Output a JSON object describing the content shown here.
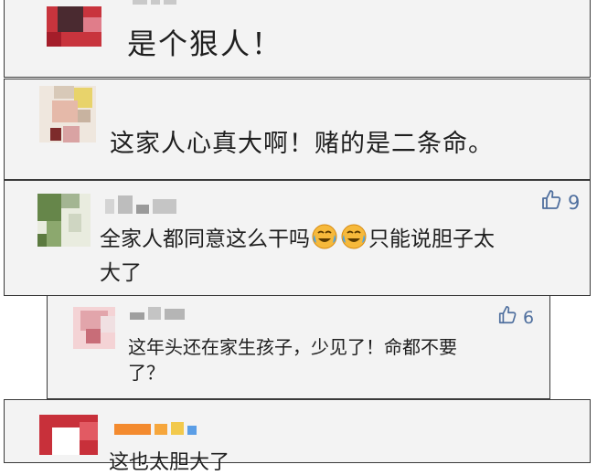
{
  "comments": [
    {
      "text": "是个狠人！"
    },
    {
      "text": "这家人心真大啊！赌的是二条命。"
    },
    {
      "text_part1": "全家人都同意这么干吗",
      "emoji": [
        "laugh-cry-emoji",
        "laugh-cry-emoji"
      ],
      "text_part2": "只能说胆子太",
      "text_part3": "大了",
      "likes": "9"
    },
    {
      "text_line1": "这年头还在家生孩子，少见了！命都不要",
      "text_line2": "了？",
      "likes": "6"
    },
    {
      "text": "这也太胆大了"
    }
  ],
  "icons": {
    "like": "thumbs-up-icon",
    "emoji": "laugh-cry-emoji"
  }
}
